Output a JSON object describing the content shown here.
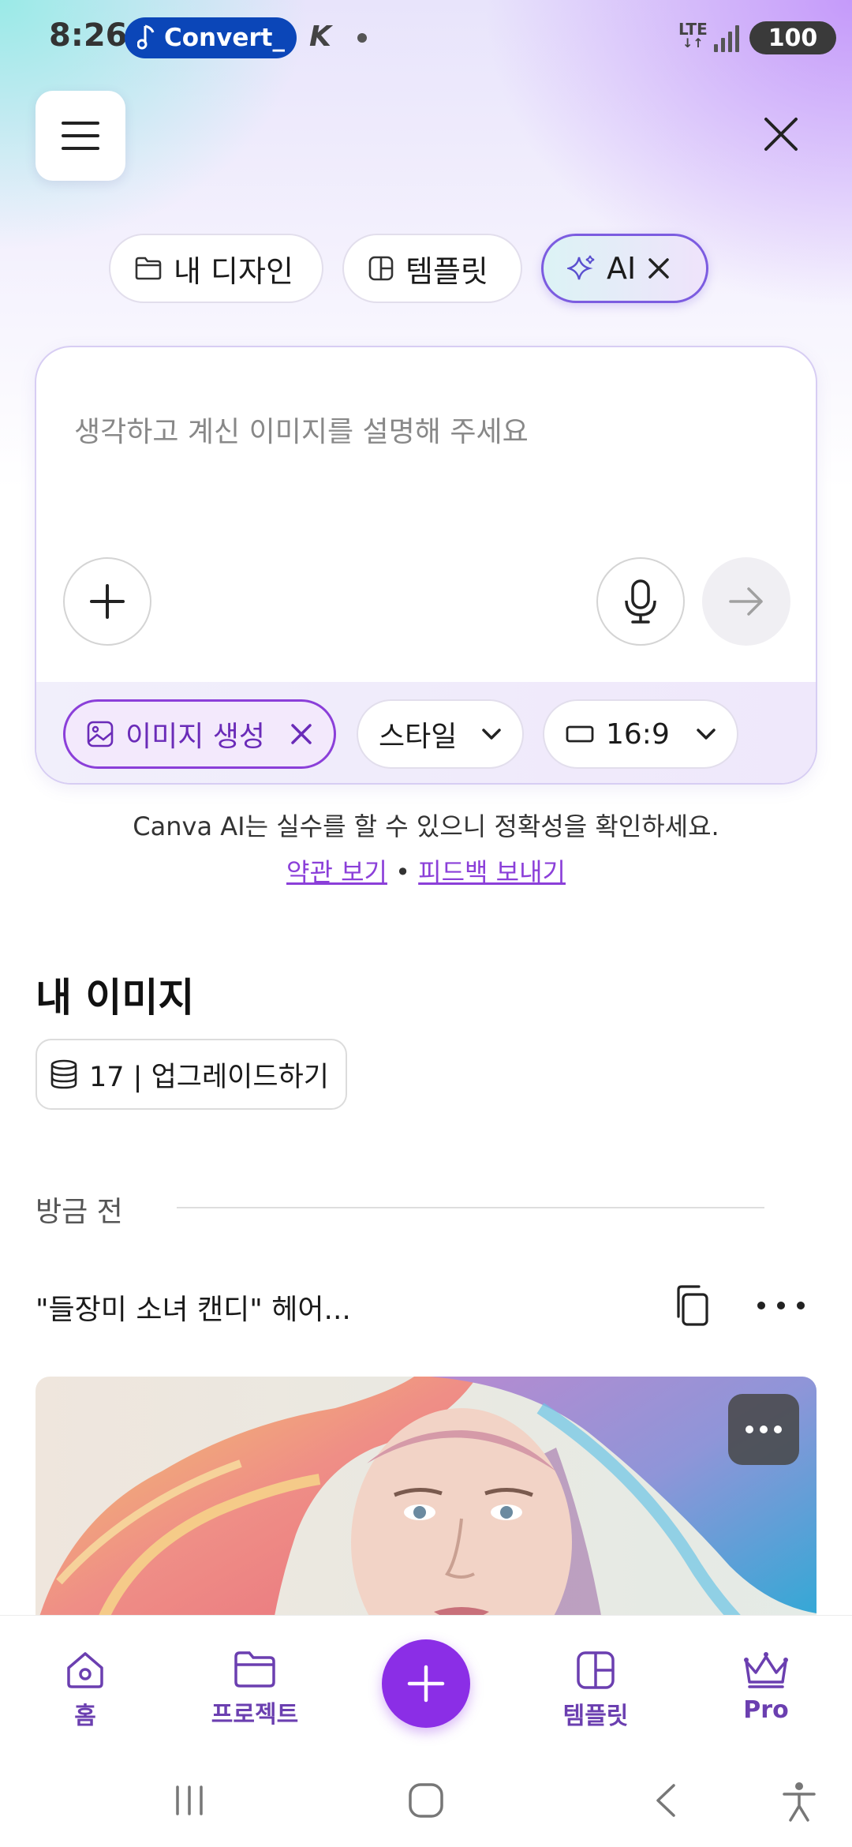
{
  "status": {
    "time": "8:26",
    "media_label": "Convert_",
    "network": "LTE",
    "battery": "100"
  },
  "tabs": [
    {
      "label": "내 디자인",
      "icon": "folder-icon"
    },
    {
      "label": "템플릿",
      "icon": "template-icon"
    },
    {
      "label": "AI",
      "icon": "sparkle-icon"
    }
  ],
  "prompt": {
    "placeholder": "생각하고 계신 이미지를 설명해 주세요"
  },
  "options": {
    "image_generate": "이미지 생성",
    "style": "스타일",
    "ratio": "16:9"
  },
  "disclaimer": "Canva AI는 실수를 할 수 있으니 정확성을 확인하세요.",
  "links": {
    "terms": "약관 보기",
    "separator": "•",
    "feedback": "피드백 보내기"
  },
  "images_section": {
    "title": "내 이미지",
    "credits": "17 | 업그레이드하기",
    "time_group": "방금 전",
    "item_title": "\"들장미 소녀 캔디\" 헤어..."
  },
  "bottom_nav": [
    {
      "label": "홈",
      "icon": "home-icon"
    },
    {
      "label": "프로젝트",
      "icon": "folder-icon"
    },
    {
      "label": "템플릿",
      "icon": "template-icon"
    },
    {
      "label": "Pro",
      "icon": "crown-icon"
    }
  ],
  "colors": {
    "accent": "#8b2ee6",
    "nav_text": "#6b3fb0",
    "link": "#8b3fd9"
  }
}
